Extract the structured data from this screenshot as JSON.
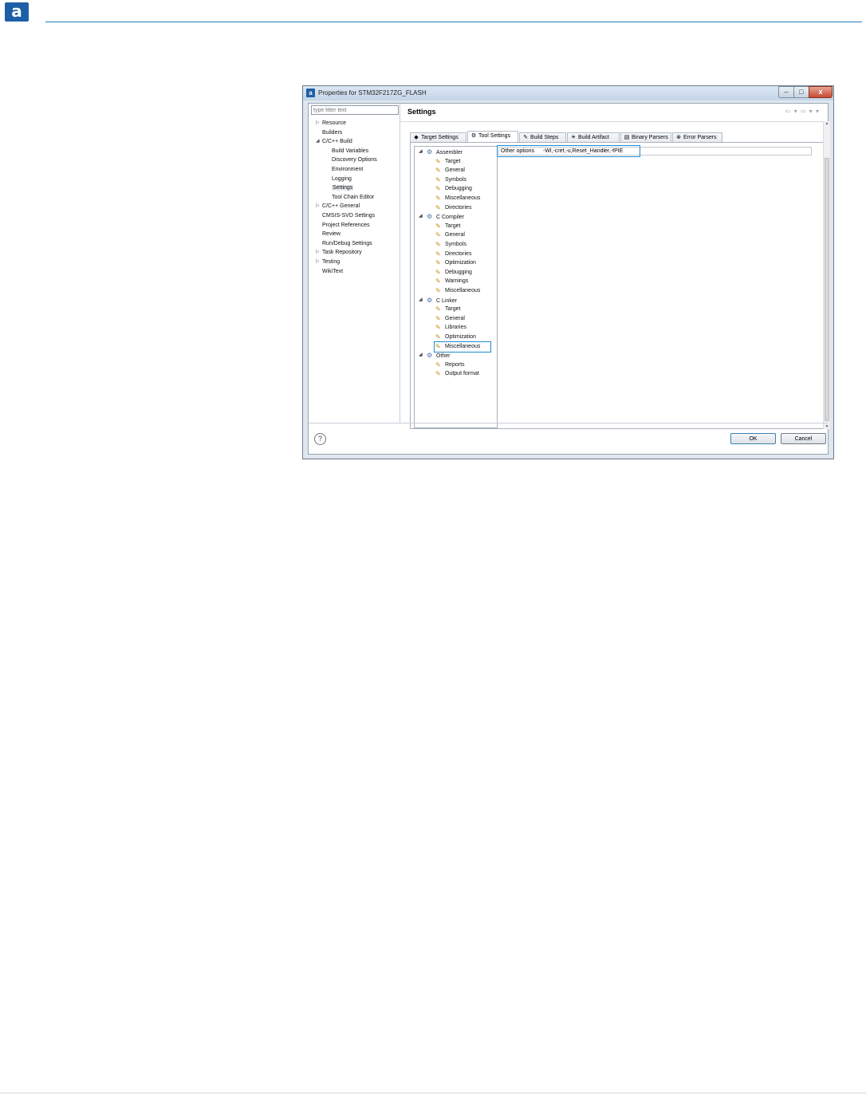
{
  "page": {
    "logo_letter": "a"
  },
  "window": {
    "title": "Properties for STM32F217ZG_FLASH",
    "app_icon_letter": "a",
    "controls": {
      "minimize": "–",
      "maximize": "□",
      "close": "x"
    }
  },
  "left": {
    "filter_placeholder": "type filter text",
    "items": [
      {
        "label": "Resource",
        "level": 0,
        "arrow": "▷"
      },
      {
        "label": "Builders",
        "level": 0,
        "arrow": ""
      },
      {
        "label": "C/C++ Build",
        "level": 0,
        "arrow": "◢"
      },
      {
        "label": "Build Variables",
        "level": 1,
        "arrow": ""
      },
      {
        "label": "Discovery Options",
        "level": 1,
        "arrow": ""
      },
      {
        "label": "Environment",
        "level": 1,
        "arrow": ""
      },
      {
        "label": "Logging",
        "level": 1,
        "arrow": ""
      },
      {
        "label": "Settings",
        "level": 1,
        "arrow": "",
        "selected": true
      },
      {
        "label": "Tool Chain Editor",
        "level": 1,
        "arrow": ""
      },
      {
        "label": "C/C++ General",
        "level": 0,
        "arrow": "▷"
      },
      {
        "label": "CMSIS-SVD Settings",
        "level": 0,
        "arrow": ""
      },
      {
        "label": "Project References",
        "level": 0,
        "arrow": ""
      },
      {
        "label": "Review",
        "level": 0,
        "arrow": ""
      },
      {
        "label": "Run/Debug Settings",
        "level": 0,
        "arrow": ""
      },
      {
        "label": "Task Repository",
        "level": 0,
        "arrow": "▷"
      },
      {
        "label": "Testing",
        "level": 0,
        "arrow": "▷"
      },
      {
        "label": "WikiText",
        "level": 0,
        "arrow": ""
      }
    ]
  },
  "right": {
    "title": "Settings",
    "nav_icons": "⇦ ▾ ⇨ ▾ ▾",
    "tabs": [
      {
        "label": "Target Settings",
        "icon": "◆"
      },
      {
        "label": "Tool Settings",
        "icon": "⚙",
        "active": true
      },
      {
        "label": "Build Steps",
        "icon": "✎"
      },
      {
        "label": "Build Artifact",
        "icon": "☀"
      },
      {
        "label": "Binary Parsers",
        "icon": "▤"
      },
      {
        "label": "Error Parsers",
        "icon": "⊗"
      }
    ],
    "tree": [
      {
        "label": "Assembler",
        "group": true
      },
      {
        "label": "Target"
      },
      {
        "label": "General"
      },
      {
        "label": "Symbols"
      },
      {
        "label": "Debugging"
      },
      {
        "label": "Miscellaneous"
      },
      {
        "label": "Directories"
      },
      {
        "label": "C Compiler",
        "group": true
      },
      {
        "label": "Target"
      },
      {
        "label": "General"
      },
      {
        "label": "Symbols"
      },
      {
        "label": "Directories"
      },
      {
        "label": "Optimization"
      },
      {
        "label": "Debugging"
      },
      {
        "label": "Warnings"
      },
      {
        "label": "Miscellaneous"
      },
      {
        "label": "C Linker",
        "group": true
      },
      {
        "label": "Target"
      },
      {
        "label": "General"
      },
      {
        "label": "Libraries"
      },
      {
        "label": "Optimization"
      },
      {
        "label": "Miscellaneous",
        "selected": true
      },
      {
        "label": "Other",
        "group": true
      },
      {
        "label": "Reports"
      },
      {
        "label": "Output format"
      }
    ],
    "other_options": {
      "label": "Other options",
      "value": "-Wl,-cref,-u,Reset_Handler,-fPIE"
    }
  },
  "buttons": {
    "help": "?",
    "ok": "OK",
    "cancel": "Cancel"
  }
}
